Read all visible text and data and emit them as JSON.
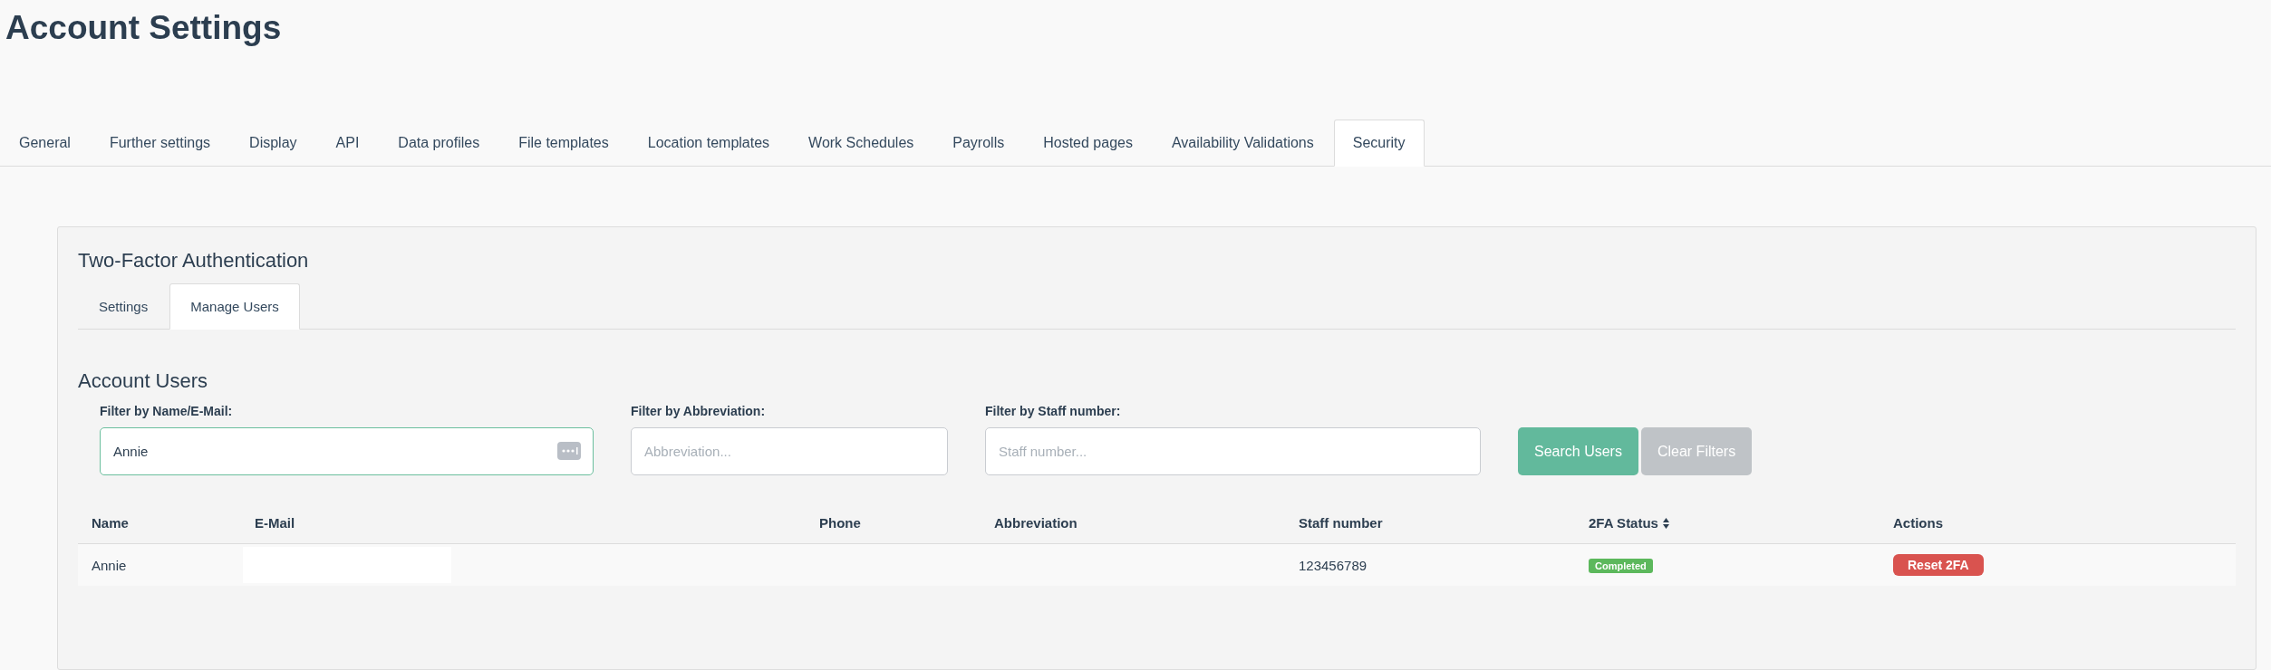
{
  "page_title": "Account Settings",
  "tabs": [
    {
      "label": "General",
      "selected": false
    },
    {
      "label": "Further settings",
      "selected": false
    },
    {
      "label": "Display",
      "selected": false
    },
    {
      "label": "API",
      "selected": false
    },
    {
      "label": "Data profiles",
      "selected": false
    },
    {
      "label": "File templates",
      "selected": false
    },
    {
      "label": "Location templates",
      "selected": false
    },
    {
      "label": "Work Schedules",
      "selected": false
    },
    {
      "label": "Payrolls",
      "selected": false
    },
    {
      "label": "Hosted pages",
      "selected": false
    },
    {
      "label": "Availability Validations",
      "selected": false
    },
    {
      "label": "Security",
      "selected": true
    }
  ],
  "panel": {
    "title": "Two-Factor Authentication",
    "tabs": [
      {
        "label": "Settings",
        "selected": false
      },
      {
        "label": "Manage Users",
        "selected": true
      }
    ],
    "section_title": "Account Users",
    "filters": [
      {
        "label": "Filter by Name/E-Mail:",
        "value": "Annie",
        "focused": true
      },
      {
        "label": "Filter by Abbreviation:",
        "placeholder": "Abbreviation...",
        "focused": false
      },
      {
        "label": "Filter by Staff number:",
        "placeholder": "Staff number...",
        "focused": false
      }
    ],
    "buttons": [
      {
        "label": "Search Users",
        "kind": "primary"
      },
      {
        "label": "Clear Filters",
        "kind": "secondary"
      }
    ],
    "table": {
      "columns": [
        {
          "label": "Name",
          "sortable": false
        },
        {
          "label": "E-Mail",
          "sortable": false
        },
        {
          "label": "Phone",
          "sortable": false
        },
        {
          "label": "Abbreviation",
          "sortable": false
        },
        {
          "label": "Staff number",
          "sortable": false
        },
        {
          "label": "2FA Status",
          "sortable": true
        },
        {
          "label": "Actions",
          "sortable": false
        }
      ],
      "rows": [
        {
          "name": "Annie",
          "email_redacted": true,
          "staff_number": "123456789",
          "status": "Completed",
          "action": "Reset 2FA"
        }
      ]
    }
  }
}
